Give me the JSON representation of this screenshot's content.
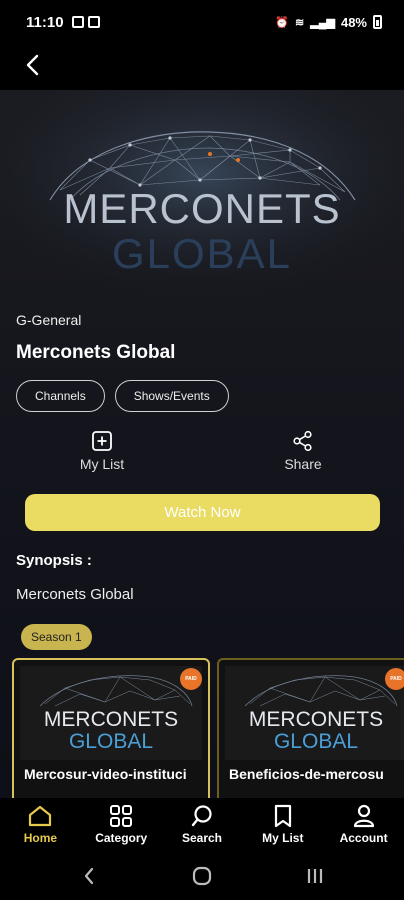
{
  "status": {
    "time": "11:10",
    "battery": "48%"
  },
  "show": {
    "logo_line1": "MERCONETS",
    "logo_line2": "GLOBAL",
    "rating": "G-General",
    "title": "Merconets Global",
    "chips": [
      "Channels",
      "Shows/Events"
    ],
    "actions": {
      "mylist_label": "My List",
      "share_label": "Share"
    },
    "watch_label": "Watch Now",
    "synopsis_heading": "Synopsis :",
    "synopsis_text": "Merconets Global",
    "season_label": "Season 1"
  },
  "episodes": [
    {
      "title": "Mercosur-video-instituci",
      "logo_line1": "MERCONETS",
      "logo_line2": "GLOBAL",
      "badge": "PAID"
    },
    {
      "title": "Beneficios-de-mercosu",
      "logo_line1": "MERCONETS",
      "logo_line2": "GLOBAL",
      "badge": "PAID"
    }
  ],
  "tabbar": [
    {
      "label": "Home",
      "icon": "home-icon"
    },
    {
      "label": "Category",
      "icon": "grid-icon"
    },
    {
      "label": "Search",
      "icon": "search-icon"
    },
    {
      "label": "My List",
      "icon": "bookmark-icon"
    },
    {
      "label": "Account",
      "icon": "person-icon"
    }
  ],
  "colors": {
    "accent_yellow": "#eadb62",
    "tab_active": "#e7c94e",
    "season_pill": "#c9b550",
    "logo_text": "#b9c2cf",
    "logo_text_blue": "#2a3f5a"
  }
}
